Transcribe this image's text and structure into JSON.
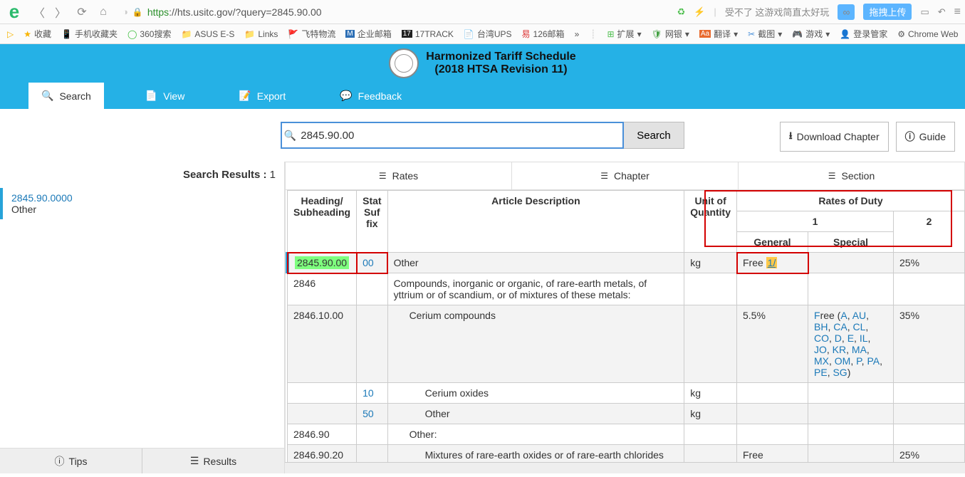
{
  "browser": {
    "url_scheme": "https",
    "url_host": "://hts.usitc.gov",
    "url_rest": "/?query=2845.90.00",
    "cn_text": "受不了 这游戏简直太好玩",
    "upload": "拖拽上传"
  },
  "bookmarks": [
    {
      "icon": "star",
      "label": "收藏"
    },
    {
      "icon": "phone",
      "label": "手机收藏夹"
    },
    {
      "icon": "360",
      "label": "360搜索"
    },
    {
      "icon": "folder",
      "label": "ASUS E-S"
    },
    {
      "icon": "folder",
      "label": "Links"
    },
    {
      "icon": "flag",
      "label": "飞特物流"
    },
    {
      "icon": "m",
      "label": "企业邮箱"
    },
    {
      "icon": "17",
      "label": "17TRACK"
    },
    {
      "icon": "doc",
      "label": "台湾UPS"
    },
    {
      "icon": "126",
      "label": "126邮箱"
    }
  ],
  "bookmarks_right": [
    {
      "label": "扩展"
    },
    {
      "label": "网银"
    },
    {
      "label": "翻译"
    },
    {
      "label": "截图"
    },
    {
      "label": "游戏"
    },
    {
      "label": "登录管家"
    },
    {
      "label": "Chrome Web"
    }
  ],
  "header": {
    "title1": "Harmonized Tariff Schedule",
    "title2": "(2018 HTSA Revision 11)",
    "tabs": [
      {
        "label": "Search",
        "icon": "🔍"
      },
      {
        "label": "View",
        "icon": "📄"
      },
      {
        "label": "Export",
        "icon": "📝"
      },
      {
        "label": "Feedback",
        "icon": "💬"
      }
    ]
  },
  "search": {
    "value": "2845.90.00",
    "button": "Search",
    "download": "Download Chapter",
    "guide": "Guide"
  },
  "left": {
    "results_label": "Search Results :",
    "results_count": "1",
    "items": [
      {
        "code": "2845.90.0000",
        "desc": "Other"
      }
    ],
    "footer": {
      "tips": "Tips",
      "results": "Results"
    }
  },
  "viewtabs": [
    {
      "label": "Rates"
    },
    {
      "label": "Chapter"
    },
    {
      "label": "Section"
    }
  ],
  "table": {
    "headers": {
      "heading": "Heading/ Subheading",
      "stat": "Stat Suf fix",
      "desc": "Article Description",
      "unit": "Unit of Quantity",
      "rates": "Rates of Duty",
      "one": "1",
      "general": "General",
      "special": "Special",
      "two": "2"
    },
    "rows": [
      {
        "shade": true,
        "heading": "2845.90.00",
        "stat": "00",
        "desc": "Other",
        "unit": "kg",
        "general": "Free",
        "general_link": "1/",
        "special": "",
        "col2": "25%",
        "marker": true,
        "hlgreen": true,
        "redrow": true
      },
      {
        "shade": false,
        "heading": "2846",
        "stat": "",
        "desc": "Compounds, inorganic or organic, of rare-earth metals, of yttrium or of scandium, or of mixtures of these metals:",
        "unit": "",
        "general": "",
        "special": "",
        "col2": ""
      },
      {
        "shade": true,
        "heading": "2846.10.00",
        "stat": "",
        "desc": "Cerium compounds",
        "indent": 1,
        "unit": "",
        "general": "5.5%",
        "special_countries": "Free (A, AU, BH, CA, CL, CO, D, E, IL, JO, KR, MA, MX, OM, P, PA, PE, SG)",
        "col2": "35%"
      },
      {
        "shade": false,
        "heading": "",
        "stat": "10",
        "desc": "Cerium oxides",
        "indent": 2,
        "unit": "kg",
        "general": "",
        "special": "",
        "col2": ""
      },
      {
        "shade": true,
        "heading": "",
        "stat": "50",
        "desc": "Other",
        "indent": 2,
        "unit": "kg",
        "general": "",
        "special": "",
        "col2": ""
      },
      {
        "shade": false,
        "heading": "2846.90",
        "stat": "",
        "desc": "Other:",
        "indent": 1,
        "unit": "",
        "general": "",
        "special": "",
        "col2": ""
      },
      {
        "shade": true,
        "heading": "2846.90.20",
        "stat": "",
        "desc": "Mixtures of rare-earth oxides or of rare-earth chlorides",
        "indent": 2,
        "unit": "",
        "general": "Free",
        "special": "",
        "col2": "25%"
      }
    ]
  }
}
